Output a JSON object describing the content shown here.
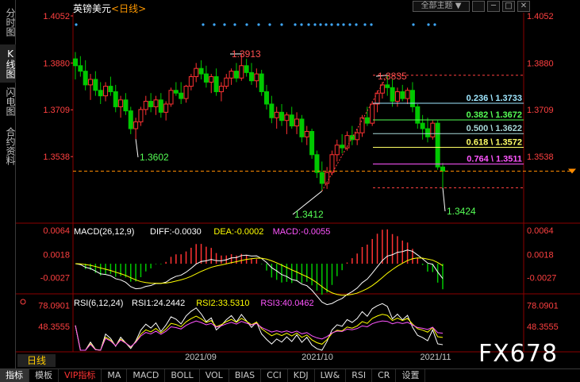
{
  "sidebar": {
    "tabs": [
      {
        "label": "分时图"
      },
      {
        "label": "K线图"
      },
      {
        "label": "闪电图"
      },
      {
        "label": "合约资料"
      }
    ]
  },
  "header": {
    "symbol": "英镑美元",
    "period_tag": "<日线>",
    "theme_button": "全部主题",
    "dropdown_icon": "triangle-down-icon"
  },
  "period_label": "日线",
  "watermark": "FX678",
  "colors": {
    "up": "#ff3232",
    "down": "#00c800",
    "background": "#000000",
    "grid": "#8b0000",
    "price_axis": "#ff4040"
  },
  "toolbar": {
    "items": [
      "指标",
      "模板",
      "VIP指标",
      "MA",
      "MACD",
      "BOLL",
      "VOL",
      "BIAS",
      "CCI",
      "KDJ",
      "LW&",
      "RSI",
      "CR",
      "设置"
    ]
  },
  "chart_data": [
    {
      "type": "candlestick",
      "panel": "price",
      "title": "英镑美元<日线>",
      "yticks": [
        "1.4052",
        "1.3880",
        "1.3709",
        "1.3538"
      ],
      "ylim": [
        1.335,
        1.4052
      ],
      "xlabels": [
        "2021/09",
        "2021/10",
        "2021/11"
      ],
      "annotations": [
        {
          "label": "1.3913",
          "type": "high"
        },
        {
          "label": "1.3602",
          "type": "low"
        },
        {
          "label": "1.3412",
          "type": "low"
        },
        {
          "label": "1.3835",
          "type": "high"
        },
        {
          "label": "1.3424",
          "type": "low"
        }
      ],
      "fibonacci": [
        {
          "label": "0.236 \\ 1.3733",
          "value": 1.3733,
          "color": "#9fe7ff"
        },
        {
          "label": "0.382 \\ 1.3672",
          "value": 1.3672,
          "color": "#55ff55"
        },
        {
          "label": "0.500 \\ 1.3622",
          "value": 1.3622,
          "color": "#a8d8d8"
        },
        {
          "label": "0.618 \\ 1.3572",
          "value": 1.3572,
          "color": "#ffff66"
        },
        {
          "label": "0.764 \\ 1.3511",
          "value": 1.3511,
          "color": "#ff55ff"
        }
      ],
      "current_price": 1.3485,
      "candles": [
        [
          1.3895,
          1.392,
          1.382,
          1.387
        ],
        [
          1.387,
          1.3905,
          1.383,
          1.385
        ],
        [
          1.385,
          1.389,
          1.378,
          1.38
        ],
        [
          1.38,
          1.384,
          1.3745,
          1.382
        ],
        [
          1.382,
          1.385,
          1.376,
          1.378
        ],
        [
          1.378,
          1.381,
          1.373,
          1.376
        ],
        [
          1.376,
          1.381,
          1.374,
          1.3795
        ],
        [
          1.3795,
          1.383,
          1.376,
          1.3775
        ],
        [
          1.3775,
          1.38,
          1.37,
          1.372
        ],
        [
          1.372,
          1.376,
          1.368,
          1.3745
        ],
        [
          1.3745,
          1.377,
          1.369,
          1.3705
        ],
        [
          1.3705,
          1.372,
          1.362,
          1.364
        ],
        [
          1.364,
          1.368,
          1.3602,
          1.3665
        ],
        [
          1.3665,
          1.372,
          1.365,
          1.371
        ],
        [
          1.371,
          1.376,
          1.369,
          1.374
        ],
        [
          1.374,
          1.377,
          1.37,
          1.372
        ],
        [
          1.372,
          1.376,
          1.369,
          1.3745
        ],
        [
          1.3745,
          1.377,
          1.368,
          1.37
        ],
        [
          1.37,
          1.374,
          1.367,
          1.373
        ],
        [
          1.373,
          1.379,
          1.372,
          1.378
        ],
        [
          1.378,
          1.381,
          1.376,
          1.377
        ],
        [
          1.377,
          1.381,
          1.373,
          1.375
        ],
        [
          1.375,
          1.38,
          1.3735,
          1.3795
        ],
        [
          1.3795,
          1.384,
          1.378,
          1.383
        ],
        [
          1.383,
          1.388,
          1.381,
          1.386
        ],
        [
          1.386,
          1.389,
          1.382,
          1.384
        ],
        [
          1.384,
          1.387,
          1.379,
          1.381
        ],
        [
          1.381,
          1.384,
          1.377,
          1.383
        ],
        [
          1.383,
          1.386,
          1.376,
          1.3775
        ],
        [
          1.3775,
          1.381,
          1.374,
          1.3795
        ],
        [
          1.3795,
          1.384,
          1.3785,
          1.3825
        ],
        [
          1.3825,
          1.386,
          1.38,
          1.385
        ],
        [
          1.385,
          1.388,
          1.381,
          1.3825
        ],
        [
          1.3825,
          1.3913,
          1.3815,
          1.387
        ],
        [
          1.387,
          1.3895,
          1.383,
          1.3845
        ],
        [
          1.3845,
          1.388,
          1.38,
          1.3815
        ],
        [
          1.3815,
          1.386,
          1.379,
          1.384
        ],
        [
          1.384,
          1.3855,
          1.376,
          1.3775
        ],
        [
          1.3775,
          1.38,
          1.371,
          1.373
        ],
        [
          1.373,
          1.376,
          1.366,
          1.368
        ],
        [
          1.368,
          1.372,
          1.364,
          1.37
        ],
        [
          1.37,
          1.373,
          1.365,
          1.367
        ],
        [
          1.367,
          1.37,
          1.362,
          1.369
        ],
        [
          1.369,
          1.372,
          1.364,
          1.365
        ],
        [
          1.365,
          1.37,
          1.362,
          1.3675
        ],
        [
          1.3675,
          1.369,
          1.359,
          1.361
        ],
        [
          1.361,
          1.365,
          1.358,
          1.363
        ],
        [
          1.363,
          1.364,
          1.353,
          1.3545
        ],
        [
          1.3545,
          1.356,
          1.346,
          1.348
        ],
        [
          1.348,
          1.352,
          1.3412,
          1.344
        ],
        [
          1.344,
          1.35,
          1.342,
          1.348
        ],
        [
          1.348,
          1.356,
          1.347,
          1.3545
        ],
        [
          1.3545,
          1.36,
          1.352,
          1.358
        ],
        [
          1.358,
          1.362,
          1.355,
          1.357
        ],
        [
          1.357,
          1.363,
          1.356,
          1.3615
        ],
        [
          1.3615,
          1.365,
          1.358,
          1.36
        ],
        [
          1.36,
          1.364,
          1.358,
          1.3625
        ],
        [
          1.3625,
          1.369,
          1.361,
          1.368
        ],
        [
          1.368,
          1.372,
          1.365,
          1.366
        ],
        [
          1.366,
          1.374,
          1.365,
          1.373
        ],
        [
          1.373,
          1.378,
          1.37,
          1.377
        ],
        [
          1.377,
          1.381,
          1.375,
          1.38
        ],
        [
          1.38,
          1.3835,
          1.376,
          1.379
        ],
        [
          1.379,
          1.382,
          1.372,
          1.374
        ],
        [
          1.374,
          1.379,
          1.372,
          1.3775
        ],
        [
          1.3775,
          1.38,
          1.374,
          1.375
        ],
        [
          1.375,
          1.379,
          1.373,
          1.378
        ],
        [
          1.378,
          1.381,
          1.37,
          1.372
        ],
        [
          1.372,
          1.373,
          1.364,
          1.366
        ],
        [
          1.366,
          1.369,
          1.36,
          1.364
        ],
        [
          1.364,
          1.368,
          1.359,
          1.361
        ],
        [
          1.361,
          1.367,
          1.36,
          1.366
        ],
        [
          1.366,
          1.367,
          1.349,
          1.35
        ],
        [
          1.35,
          1.3515,
          1.3424,
          1.3485
        ]
      ]
    },
    {
      "type": "line",
      "panel": "macd",
      "title": "MACD(26,12,9)",
      "readouts": [
        {
          "name": "DIFF",
          "text": "DIFF:-0.0030",
          "color": "#ffffff"
        },
        {
          "name": "DEA",
          "text": "DEA:-0.0002",
          "color": "#ffff00"
        },
        {
          "name": "MACD",
          "text": "MACD:-0.0055",
          "color": "#ff55ff"
        }
      ],
      "yticks": [
        "0.0064",
        "0.0018",
        "-0.0027"
      ],
      "ylim": [
        -0.0055,
        0.0072
      ]
    },
    {
      "type": "line",
      "panel": "rsi",
      "title": "RSI(6,12,24)",
      "readouts": [
        {
          "name": "RSI1",
          "text": "RSI1:24.2442",
          "color": "#ffffff"
        },
        {
          "name": "RSI2",
          "text": "RSI2:33.5310",
          "color": "#ffff00"
        },
        {
          "name": "RSI3",
          "text": "RSI3:40.0462",
          "color": "#ff55ff"
        }
      ],
      "yticks": [
        "78.0901",
        "48.3555"
      ],
      "ylim": [
        15,
        90
      ]
    }
  ]
}
